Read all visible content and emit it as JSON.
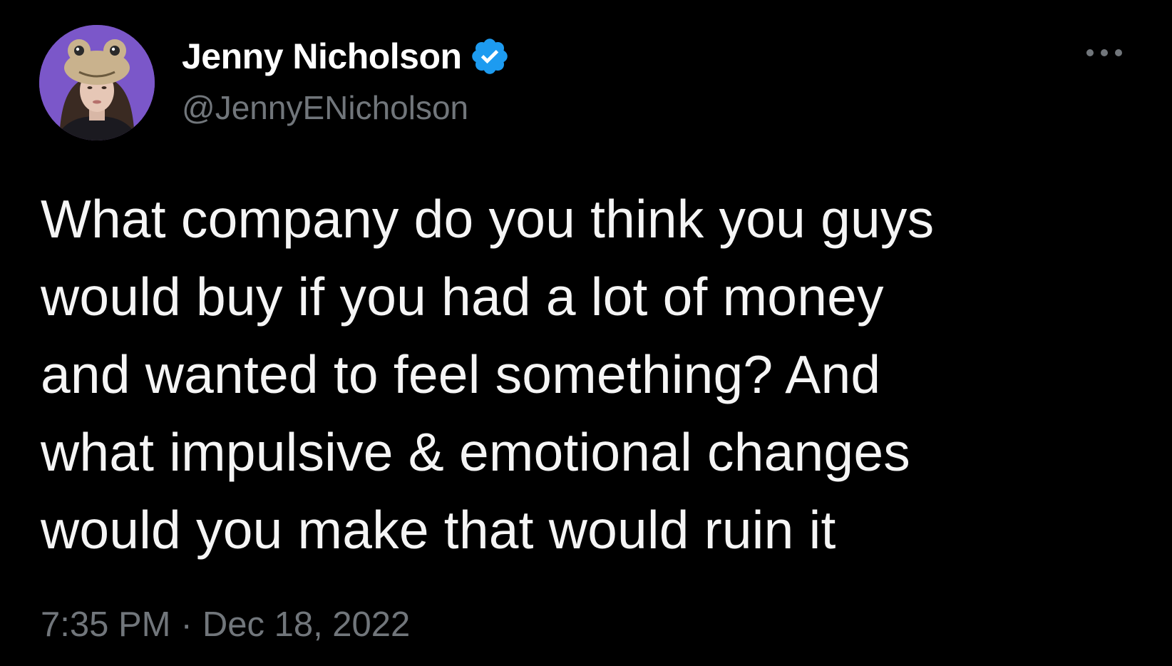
{
  "author": {
    "display_name": "Jenny Nicholson",
    "handle": "@JennyENicholson",
    "verified": true,
    "verified_icon": "verified-badge-icon",
    "avatar_icon": "user-avatar"
  },
  "tweet": {
    "lines": [
      "What company do you think you guys",
      "would buy if you had a lot of money",
      "and wanted to feel something? And",
      "what impulsive & emotional changes",
      "would you make that would ruin it"
    ],
    "time": "7:35 PM",
    "separator": "·",
    "date": "Dec 18, 2022"
  },
  "menu": {
    "icon": "more-options-icon"
  },
  "colors": {
    "background": "#000000",
    "text": "#f5f5f5",
    "secondary_text": "#71767b",
    "verified_blue": "#1d9bf0",
    "avatar_background": "#7b57c9"
  }
}
